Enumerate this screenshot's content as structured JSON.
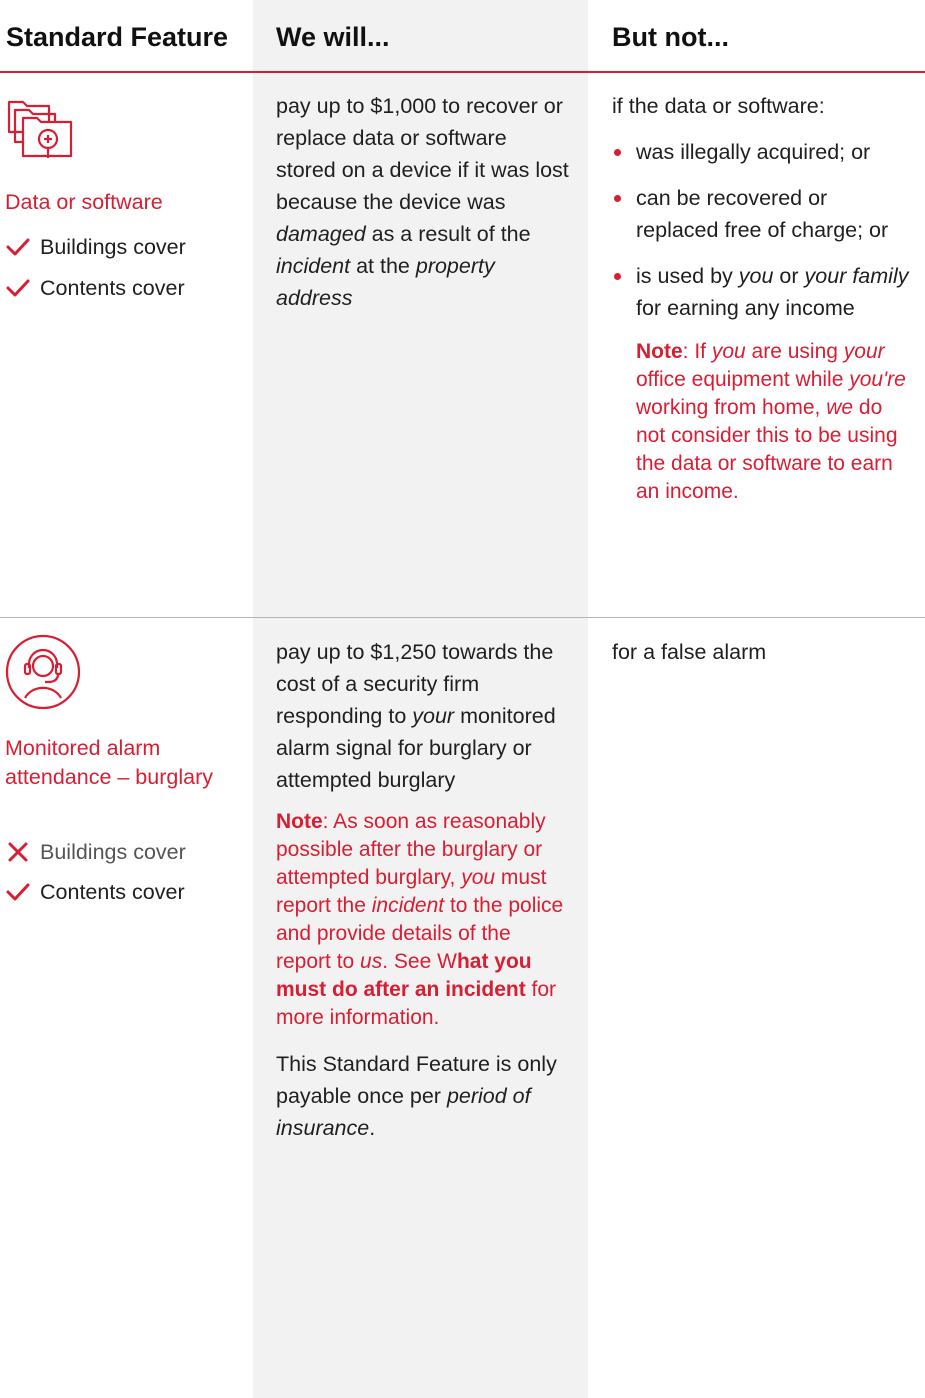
{
  "headers": {
    "feature": "Standard Feature",
    "will": "We will...",
    "not": "But not..."
  },
  "colors": {
    "accent": "#d81e33",
    "shade": "#f2f2f2"
  },
  "rows": [
    {
      "icon": "folders-search-icon",
      "title": "Data or software",
      "covers": [
        {
          "label": "Buildings cover",
          "included": true
        },
        {
          "label": "Contents cover",
          "included": true
        }
      ],
      "will": {
        "a": "pay up to $1,000 to recover or replace data or software stored on a device if it was lost because the device was ",
        "b": "damaged",
        "c": " as a result of the ",
        "d": "incident",
        "e": " at the ",
        "f": "property address"
      },
      "not": {
        "intro": "if the data or software:",
        "b1": "was illegally acquired; or",
        "b2": "can be recovered or replaced free of charge; or",
        "b3a": "is used by ",
        "b3b": "you",
        "b3c": " or ",
        "b3d": "your family",
        "b3e": " for earning any income",
        "note_label": "Note",
        "n1": ": If ",
        "n2": "you",
        "n3": " are using ",
        "n4": "your",
        "n5": " office equipment while ",
        "n6": "you're",
        "n7": " working from home, ",
        "n8": "we",
        "n9": " do not consider this to be using the data or software to earn an income."
      }
    },
    {
      "icon": "headset-person-icon",
      "title": "Monitored alarm attendance – burglary",
      "covers": [
        {
          "label": "Buildings cover",
          "included": false
        },
        {
          "label": "Contents cover",
          "included": true
        }
      ],
      "will": {
        "a": "pay up to $1,250 towards the cost of a security firm responding to ",
        "b": "your",
        "c": " monitored alarm signal for burglary or attempted burglary",
        "note_label": "Note",
        "n1": ": As soon as reasonably possible after the burglary or attempted burglary, ",
        "n2": "you",
        "n3": " must report the ",
        "n4": "incident",
        "n5": " to the police and provide details of the report to ",
        "n6": "us",
        "n7": ". See W",
        "n8": "hat you must do after an incident",
        "n9": " for more information.",
        "p1": "This Standard Feature is only payable once per ",
        "p2": "period of insurance",
        "p3": "."
      },
      "not": {
        "intro": "for a false alarm"
      }
    }
  ]
}
